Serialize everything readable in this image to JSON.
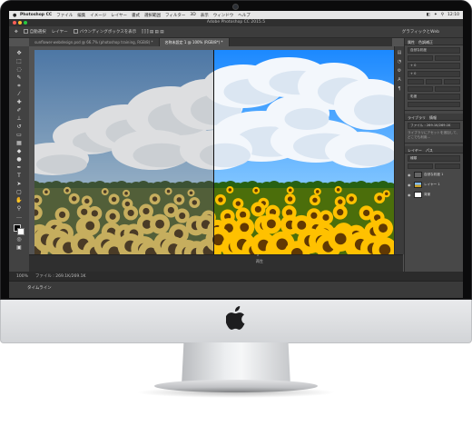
{
  "menubar": {
    "app_name": "Photoshop CC",
    "items": [
      "ファイル",
      "編集",
      "イメージ",
      "レイヤー",
      "書式",
      "選択範囲",
      "フィルター",
      "3D",
      "表示",
      "ウィンドウ",
      "ヘルプ"
    ],
    "status": [
      "◧",
      "✦",
      "⚲",
      "12:10"
    ]
  },
  "titlebar": {
    "title": "Adobe Photoshop CC 2015.5"
  },
  "options_bar": {
    "auto_select": "自動選択",
    "layer_select": "レイヤー",
    "show_transform": "バウンディングボックスを表示",
    "workspace": "グラフィックとWeb"
  },
  "tabs": [
    {
      "label": "sunflower-webdesign.psd @ 66.7% (photoshop training, RGB/8) *"
    },
    {
      "label": "名称未設定 1 @ 100% (RGB/8*) *"
    }
  ],
  "timeline": {
    "label": "再生"
  },
  "status_bar": {
    "zoom": "100%",
    "doc": "ファイル : 269.1K/269.1K"
  },
  "bottom_panel": {
    "tab": "タイムライン"
  },
  "panels": {
    "tabs": [
      "属性",
      "色調補正"
    ],
    "rows": [
      "自然な彩度",
      "自然な彩度",
      "彩度"
    ],
    "values": [
      "+ 0",
      "+ 0"
    ],
    "lib_tabs": [
      "ライブラリ",
      "情報"
    ],
    "lib_row": "ファイル : 269.1K/269.1K",
    "lib_text": "ライブラリにアセットを追加して、どこでも利用...",
    "layers_tabs": [
      "レイヤー",
      "パス"
    ],
    "kind_label": "種類",
    "layers": [
      {
        "name": "自然な彩度 1"
      },
      {
        "name": "レイヤー 1"
      },
      {
        "name": "背景"
      }
    ]
  }
}
